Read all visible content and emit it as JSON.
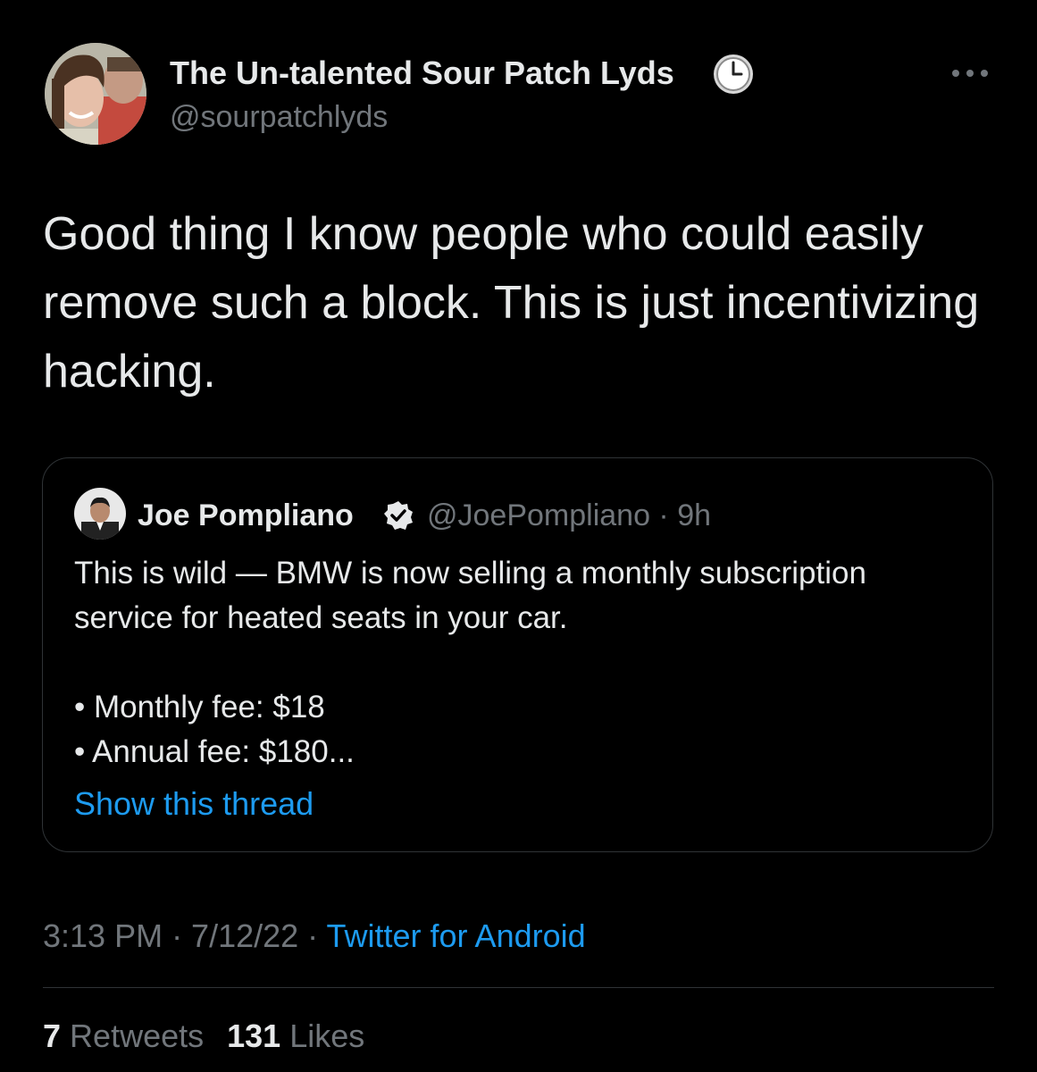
{
  "tweet": {
    "author": {
      "display_name": "The Un-talented Sour Patch Lyds",
      "handle": "@sourpatchlyds",
      "status_icon": "clock-emoji-icon"
    },
    "menu_icon": "more-options-icon",
    "text": "Good thing I know people who could easily remove such a block. This is just incentivizing hacking.",
    "timestamp": "3:13 PM · 7/12/22 · ",
    "source": "Twitter for Android",
    "stats": {
      "retweets_count": "7",
      "retweets_label": "Retweets",
      "likes_count": "131",
      "likes_label": "Likes"
    }
  },
  "quoted_tweet": {
    "author": {
      "display_name": "Joe Pompliano",
      "verified_icon": "verified-badge-icon",
      "handle_time": "@JoePompliano · 9h"
    },
    "text_lines": [
      "This is wild — BMW is now selling a monthly subscription service for heated seats in your car.",
      "",
      "• Monthly fee: $18",
      "• Annual fee: $180..."
    ],
    "show_thread": "Show this thread"
  },
  "colors": {
    "background": "#000000",
    "primary_text": "#e7e9ea",
    "secondary_text": "#71767b",
    "link": "#1d9bf0",
    "border": "#2f3336"
  }
}
